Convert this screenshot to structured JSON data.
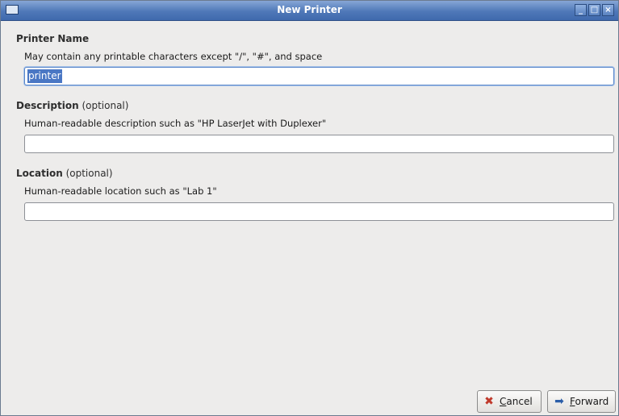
{
  "window": {
    "title": "New Printer",
    "minimize_label": "_",
    "maximize_label": "□",
    "close_label": "×"
  },
  "printer_name": {
    "heading": "Printer Name",
    "hint": "May contain any printable characters except \"/\", \"#\", and space",
    "value": "printer"
  },
  "description": {
    "heading": "Description",
    "optional": " (optional)",
    "hint": "Human-readable description such as \"HP LaserJet with Duplexer\"",
    "value": ""
  },
  "location": {
    "heading": "Location",
    "optional": " (optional)",
    "hint": "Human-readable location such as \"Lab 1\"",
    "value": ""
  },
  "buttons": {
    "cancel_first": "C",
    "cancel_rest": "ancel",
    "forward_first": "F",
    "forward_rest": "orward",
    "cancel_icon": "close-icon",
    "forward_icon": "arrow-right-icon"
  },
  "colors": {
    "titlebar": "#4f78b8",
    "selection": "#4a77c4",
    "background": "#edeceb"
  }
}
